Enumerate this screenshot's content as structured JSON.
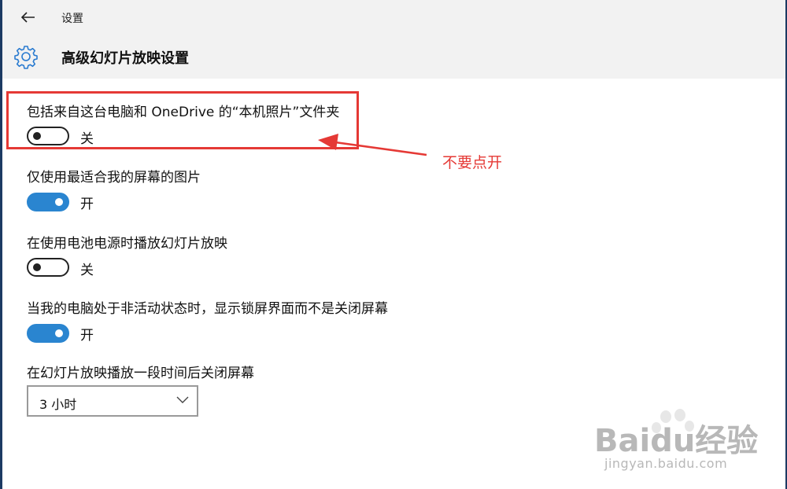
{
  "header": {
    "app_title": "设置",
    "page_title": "高级幻灯片放映设置"
  },
  "settings": [
    {
      "label": "包括来自这台电脑和 OneDrive 的“本机照片”文件夹",
      "state": "关",
      "on": false
    },
    {
      "label": "仅使用最适合我的屏幕的图片",
      "state": "开",
      "on": true
    },
    {
      "label": "在使用电池电源时播放幻灯片放映",
      "state": "关",
      "on": false
    },
    {
      "label": "当我的电脑处于非活动状态时，显示锁屏界面而不是关闭屏幕",
      "state": "开",
      "on": true
    }
  ],
  "screen_off": {
    "label": "在幻灯片放映播放一段时间后关闭屏幕",
    "selected": "3 小时"
  },
  "annotation": {
    "text": "不要点开",
    "color": "#e53935"
  },
  "watermark": {
    "brand": "Baidu经验",
    "url": "jingyan.baidu.com"
  },
  "colors": {
    "toggle_on": "#2a85d0",
    "header_bg": "#f2f2f2"
  }
}
